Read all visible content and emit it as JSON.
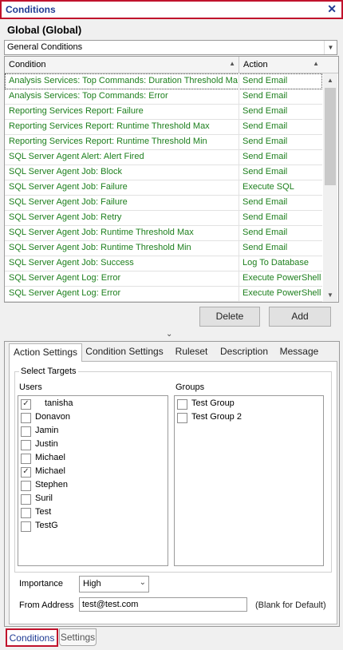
{
  "window": {
    "title": "Conditions",
    "close_glyph": "✕"
  },
  "scope_label": "Global (Global)",
  "conditions_combo": {
    "value": "General Conditions"
  },
  "grid": {
    "columns": [
      "Condition",
      "Action"
    ],
    "rows": [
      {
        "condition": "Analysis Services: Top Commands: Duration Threshold Max",
        "action": "Send Email"
      },
      {
        "condition": "Analysis Services: Top Commands: Error",
        "action": "Send Email"
      },
      {
        "condition": "Reporting Services Report: Failure",
        "action": "Send Email"
      },
      {
        "condition": "Reporting Services Report: Runtime Threshold Max",
        "action": "Send Email"
      },
      {
        "condition": "Reporting Services Report: Runtime Threshold Min",
        "action": "Send Email"
      },
      {
        "condition": "SQL Server Agent Alert: Alert Fired",
        "action": "Send Email"
      },
      {
        "condition": "SQL Server Agent Job: Block",
        "action": "Send Email"
      },
      {
        "condition": "SQL Server Agent Job: Failure",
        "action": "Execute SQL"
      },
      {
        "condition": "SQL Server Agent Job: Failure",
        "action": "Send Email"
      },
      {
        "condition": "SQL Server Agent Job: Retry",
        "action": "Send Email"
      },
      {
        "condition": "SQL Server Agent Job: Runtime Threshold Max",
        "action": "Send Email"
      },
      {
        "condition": "SQL Server Agent Job: Runtime Threshold Min",
        "action": "Send Email"
      },
      {
        "condition": "SQL Server Agent Job: Success",
        "action": "Log To Database"
      },
      {
        "condition": "SQL Server Agent Log: Error",
        "action": "Execute PowerShell"
      },
      {
        "condition": "SQL Server Agent Log: Error",
        "action": "Execute PowerShell"
      }
    ]
  },
  "buttons": {
    "delete": "Delete",
    "add": "Add"
  },
  "tabs": [
    "Action Settings",
    "Condition Settings",
    "Ruleset",
    "Description",
    "Message"
  ],
  "select_targets": {
    "legend": "Select Targets",
    "users_label": "Users",
    "groups_label": "Groups",
    "users": [
      {
        "name": "tanisha",
        "checked": true
      },
      {
        "name": "Donavon",
        "checked": false
      },
      {
        "name": "Jamin",
        "checked": false
      },
      {
        "name": "Justin",
        "checked": false
      },
      {
        "name": "Michael",
        "checked": false
      },
      {
        "name": "Michael",
        "checked": true
      },
      {
        "name": "Stephen",
        "checked": false
      },
      {
        "name": "Suril",
        "checked": false
      },
      {
        "name": "Test",
        "checked": false
      },
      {
        "name": "TestG",
        "checked": false
      }
    ],
    "groups": [
      {
        "name": "Test Group",
        "checked": false
      },
      {
        "name": "Test Group 2",
        "checked": false
      }
    ]
  },
  "importance": {
    "label": "Importance",
    "value": "High"
  },
  "from_address": {
    "label": "From Address",
    "value": "test@test.com",
    "hint": "(Blank for Default)"
  },
  "bottom_tabs": [
    "Conditions",
    "Settings"
  ],
  "colors": {
    "accent_red": "#c0122c",
    "title_blue": "#1f3a93",
    "row_green": "#1d7f1d"
  }
}
